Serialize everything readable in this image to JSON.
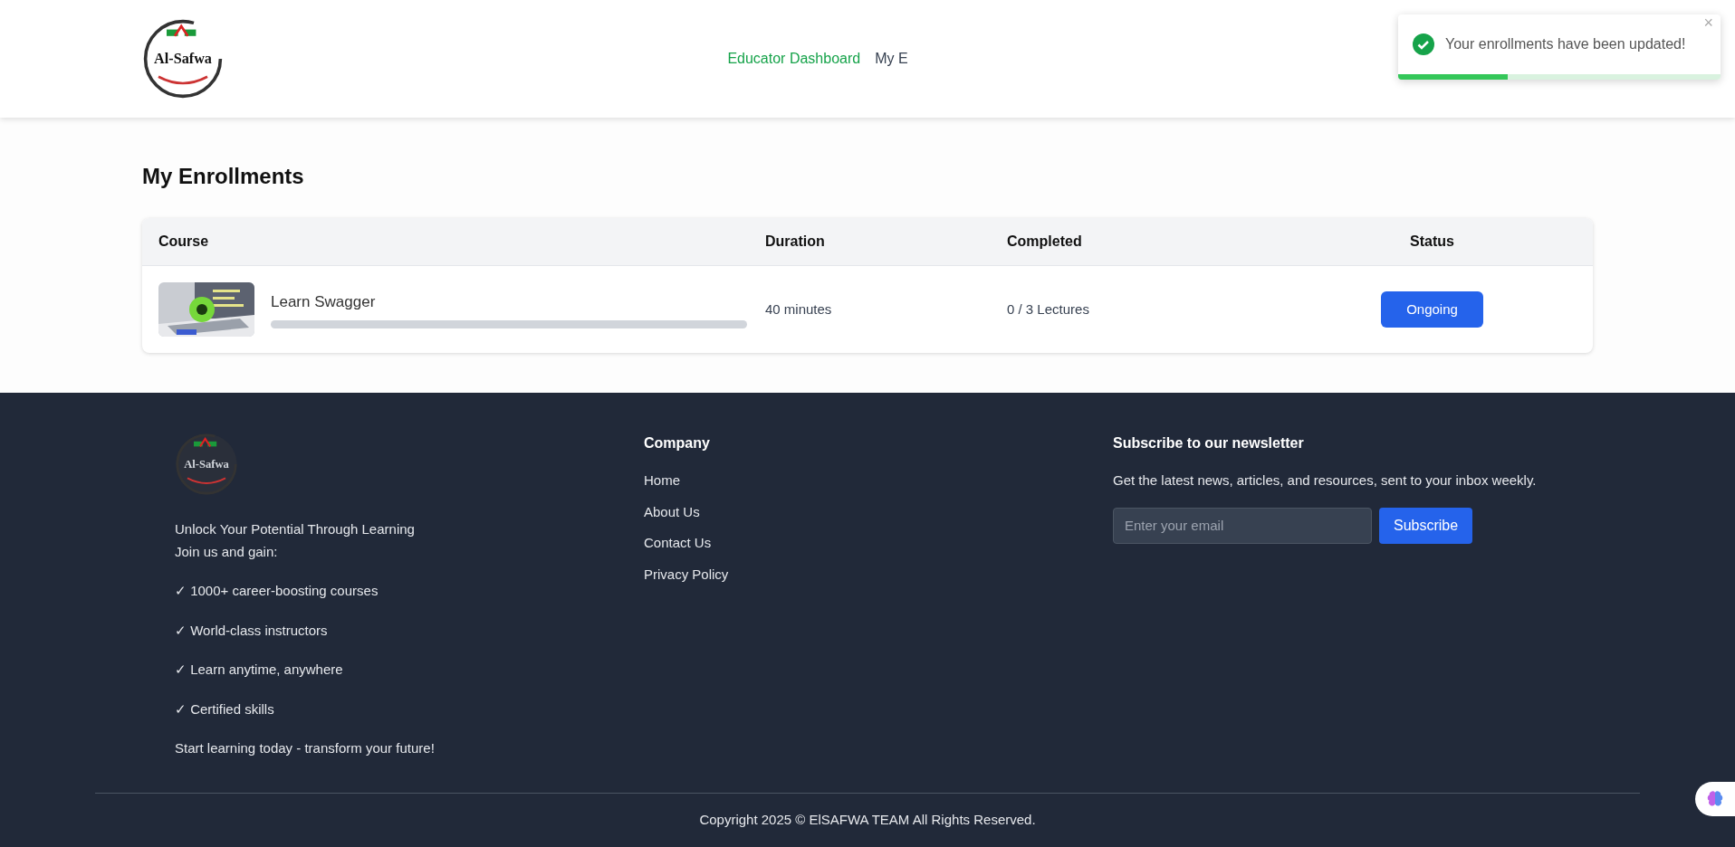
{
  "header": {
    "logo_text": "Al-Safwa",
    "nav": [
      {
        "label": "Educator Dashboard",
        "selected": true
      },
      {
        "label": "My E",
        "selected": false
      }
    ]
  },
  "toast": {
    "message": "Your enrollments have been updated!",
    "close": "×",
    "level": 0.34
  },
  "page": {
    "title": "My Enrollments"
  },
  "table": {
    "columns": [
      "Course",
      "Duration",
      "Completed",
      "Status"
    ],
    "rows": [
      {
        "course": "Learn Swagger",
        "level": 0,
        "duration": "40 minutes",
        "completed": "0 / 3 Lectures",
        "status": "Ongoing"
      }
    ]
  },
  "footer": {
    "logo_text": "Al-Safwa",
    "tagline": "Unlock Your Potential Through Learning",
    "intro": "Join us and gain:",
    "benefits": [
      "✓ 1000+ career-boosting courses",
      "✓ World-class instructors",
      "✓ Learn anytime, anywhere",
      "✓ Certified skills"
    ],
    "closing": "Start learning today - transform your future!",
    "company": {
      "title": "Company",
      "links": [
        "Home",
        "About Us",
        "Contact Us",
        "Privacy Policy"
      ]
    },
    "newsletter": {
      "title": "Subscribe to our newsletter",
      "text": "Get the latest news, articles, and resources, sent to your inbox weekly.",
      "placeholder": "Enter your email",
      "button": "Subscribe"
    },
    "copyright": "Copyright 2025 © ElSAFWA TEAM All Rights Reserved."
  }
}
